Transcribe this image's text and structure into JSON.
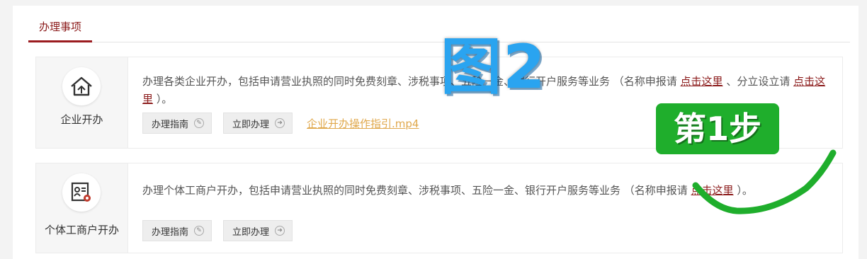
{
  "tabs": [
    {
      "label": "办理事项",
      "active": true
    }
  ],
  "services": [
    {
      "title": "企业开办",
      "icon": "house-building-icon",
      "description_parts": [
        "办理各类企业开办，包括申请营业执照的同时免费刻章、涉税事项、五险一金、银行开户服务等业务 （名称申报请 ",
        "点击这里",
        " 、分立设立请 ",
        "点击这里",
        " ）。"
      ],
      "buttons": {
        "guide": "办理指南",
        "apply": "立即办理"
      },
      "video_link": "企业开办操作指引.mp4"
    },
    {
      "title": "个体工商户开办",
      "icon": "license-gear-icon",
      "description_parts": [
        "办理个体工商户开办，包括申请营业执照的同时免费刻章、涉税事项、五险一金、银行开户服务等业务 （名称申报请 ",
        "点击这里",
        " ）。"
      ],
      "buttons": {
        "guide": "办理指南",
        "apply": "立即办理"
      }
    }
  ],
  "annotations": {
    "figure_label": "图2",
    "step_label": "第1步",
    "accent_blue": "#2aa4f0",
    "accent_green": "#1fae2c"
  },
  "colors": {
    "brand_red": "#9b1c20",
    "link_red": "#8b1a1a",
    "video_link": "#e0a84c"
  }
}
